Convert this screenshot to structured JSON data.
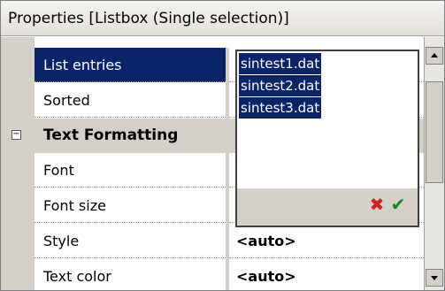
{
  "header": {
    "title": "Properties  [Listbox (Single selection)]"
  },
  "properties": [
    {
      "name": "List entries",
      "value": ""
    },
    {
      "name": "Sorted",
      "value": ""
    }
  ],
  "category": {
    "toggle": "−",
    "label": "Text Formatting"
  },
  "format_properties": [
    {
      "name": "Font",
      "value": ""
    },
    {
      "name": "Font size",
      "value": ""
    },
    {
      "name": "Style",
      "value": "<auto>"
    },
    {
      "name": "Text color",
      "value": "<auto>"
    }
  ],
  "editor": {
    "entries": [
      "sintest1.dat",
      "sintest2.dat",
      "sintest3.dat"
    ],
    "cancel_icon": "cancel-x-icon",
    "ok_icon": "ok-check-icon",
    "cancel_glyph": "✖",
    "ok_glyph": "✔"
  },
  "colors": {
    "selection": "#0a246a",
    "cancel": "#d22020",
    "ok": "#0c8a1e"
  }
}
